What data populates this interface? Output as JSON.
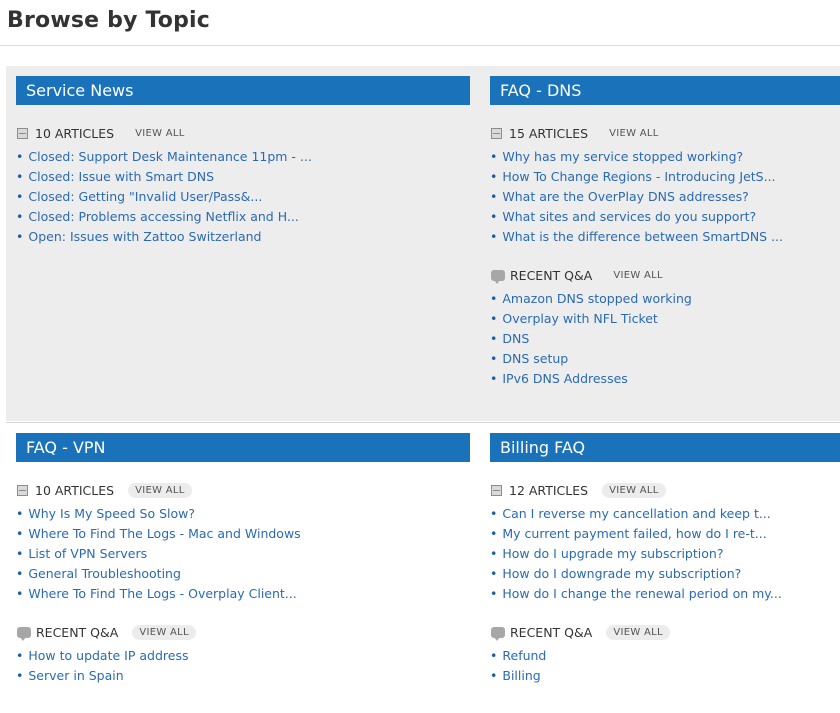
{
  "page_title": "Browse by Topic",
  "cards": {
    "service_news": {
      "title": "Service News",
      "articles": {
        "count_label": "10 ARTICLES",
        "view_all": "VIEW ALL",
        "items": [
          "Closed: Support Desk Maintenance 11pm - ...",
          "Closed: Issue with Smart DNS",
          "Closed: Getting \"Invalid User/Pass&...",
          "Closed: Problems accessing Netflix and H...",
          "Open: Issues with Zattoo Switzerland"
        ]
      }
    },
    "faq_dns": {
      "title": "FAQ - DNS",
      "articles": {
        "count_label": "15 ARTICLES",
        "view_all": "VIEW ALL",
        "items": [
          "Why has my service stopped working?",
          "How To Change Regions - Introducing JetS...",
          "What are the OverPlay DNS addresses?",
          "What sites and services do you support?",
          "What is the difference between SmartDNS ..."
        ]
      },
      "qa": {
        "label": "RECENT Q&A",
        "view_all": "VIEW ALL",
        "items": [
          "Amazon DNS stopped working",
          "Overplay with NFL Ticket",
          "DNS",
          "DNS setup",
          "IPv6 DNS Addresses"
        ]
      }
    },
    "faq_vpn": {
      "title": "FAQ - VPN",
      "articles": {
        "count_label": "10 ARTICLES",
        "view_all": "VIEW ALL",
        "items": [
          "Why Is My Speed So Slow?",
          "Where To Find The Logs - Mac and Windows",
          "List of VPN Servers",
          "General Troubleshooting",
          "Where To Find The Logs - Overplay Client..."
        ]
      },
      "qa": {
        "label": "RECENT Q&A",
        "view_all": "VIEW ALL",
        "items": [
          "How to update IP address",
          "Server in Spain"
        ]
      }
    },
    "billing_faq": {
      "title": "Billing FAQ",
      "articles": {
        "count_label": "12 ARTICLES",
        "view_all": "VIEW ALL",
        "items": [
          "Can I reverse my cancellation and keep t...",
          "My current payment failed, how do I re-t...",
          "How do I upgrade my subscription?",
          "How do I downgrade my subscription?",
          "How do I change the renewal period on my..."
        ]
      },
      "qa": {
        "label": "RECENT Q&A",
        "view_all": "VIEW ALL",
        "items": [
          "Refund",
          "Billing"
        ]
      }
    }
  },
  "icons": {
    "articles_icon": "document-icon",
    "qa_icon": "speech-bubble-icon"
  },
  "colors": {
    "header_bar": "#1a72bb",
    "link": "#2a6ab3",
    "top_band": "#ededed"
  }
}
